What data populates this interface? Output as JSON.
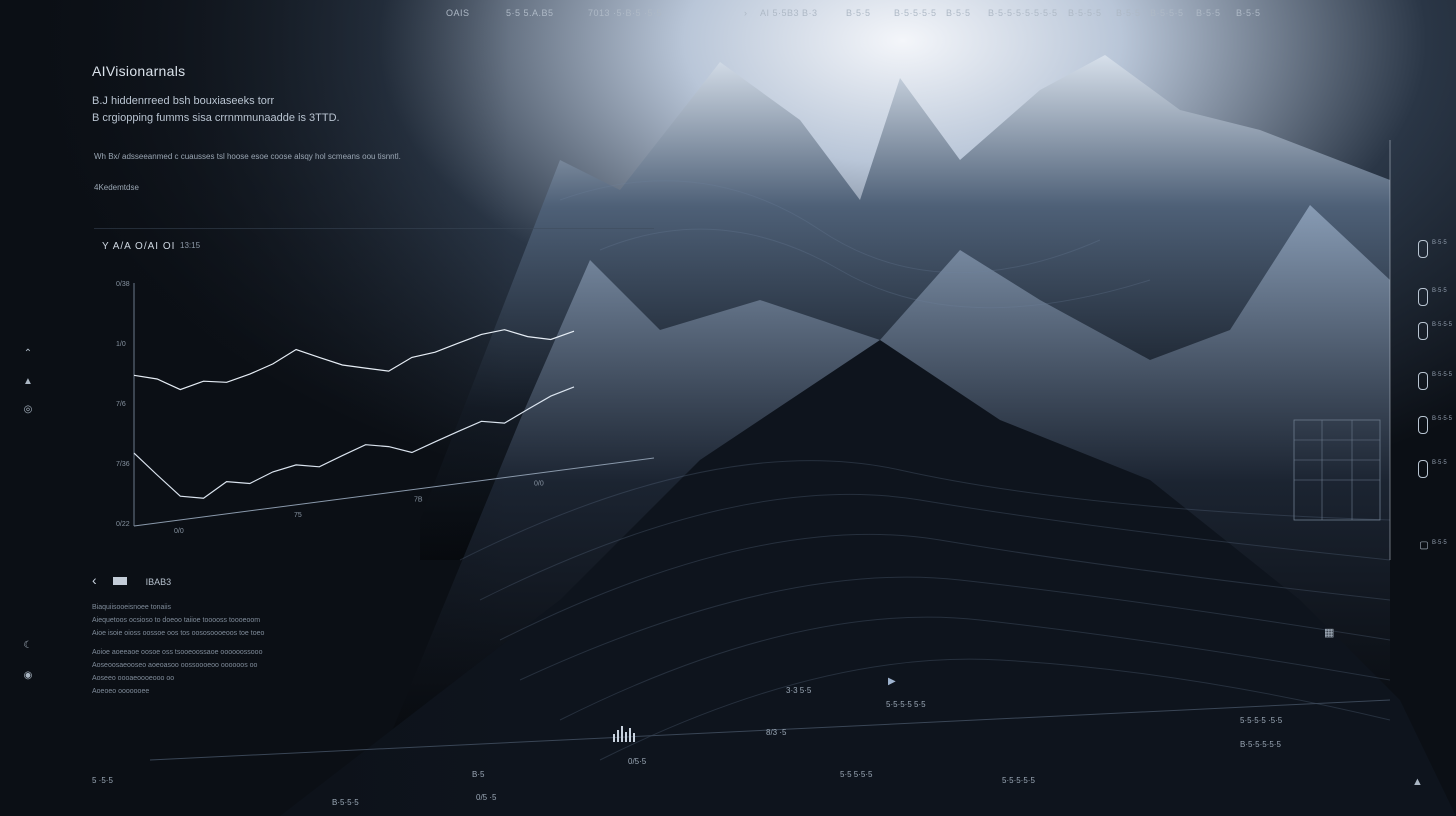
{
  "topnav": {
    "items": [
      "OAIS",
      "5·5 5.A.B5",
      "7013 ·5·B·5 ·5·5",
      "AI 5·5B3 B·3",
      "B·5·5",
      "B·5·5·5·5",
      "B·5·5",
      "B·5·5·5·5·5·5·5",
      "B·5·5·5",
      "B·5·5",
      "B·5·5·5",
      "B·5·5",
      "B·5·5"
    ]
  },
  "header": {
    "title": "AIVisionarnals",
    "line1": "B.J hiddenrreed bsh bouxiaseeks torr",
    "line2": "B crgiopping fumms sisa crrnmmunaadde is 3TTD.",
    "line3": "Wh Bx/ adsseeanmed c cuausses tsl hoose esoe coose alsqy hol scmeans oou tisnntl.",
    "line4": "4Kedemtdse"
  },
  "chart": {
    "title": "Y A/A O/AI OI",
    "subtitle": "13:15",
    "y_ticks": [
      "0/38",
      "1/0",
      "7/6",
      "7/36",
      "0/22"
    ],
    "x_ticks": [
      "0/0",
      "75",
      "7B",
      "0/0"
    ]
  },
  "chart_data": {
    "type": "line",
    "title": "Y A/A O/AI OI",
    "series": [
      {
        "values": [
          62,
          60,
          55,
          58,
          57,
          60,
          64,
          70,
          66,
          62,
          60,
          58,
          64,
          66,
          70,
          74,
          76,
          72,
          70,
          74
        ]
      },
      {
        "values": [
          30,
          20,
          10,
          8,
          14,
          12,
          16,
          18,
          16,
          20,
          24,
          22,
          18,
          22,
          26,
          30,
          28,
          34,
          40,
          44
        ]
      }
    ],
    "ylim": [
      0,
      100
    ]
  },
  "left_icons": [
    "chevron-up-icon",
    "bell-icon",
    "shield-icon",
    "moon-icon",
    "settings-icon"
  ],
  "left_panel": {
    "heading": "IBAB3",
    "lines": [
      "Biaquiisooeisnoee tonaiis",
      "Aiequetoos ocsioso to doeoo taiioe tooooss toooeoom",
      "Aioe isoie oioss oossoe oos tos oososoooeoos toe toeo",
      "Aoioe aoeeaoe oosoe oss tsooeoossaoe oooooossooo",
      "Aoseoosaeooseo aoeoasoo oossoooeoo oooooos oo",
      "Aoseeo oooaeoooeooo oo",
      "Aoeoeo ooooooee"
    ]
  },
  "bottom": {
    "items": [
      "5 ·5·5",
      "B·5·5·5",
      "B·5",
      "0/5 ·5",
      "0/5·5",
      "8/3 ·5",
      "3·3 5·5",
      "5·5·5·5 5·5",
      "5·5 5·5·5",
      "5·5·5·5·5",
      "5·5·5·5 ·5·5",
      "B·5·5·5·5·5"
    ]
  },
  "right_rail": {
    "labels": [
      "B·5·5",
      "B·5·5",
      "B·5·5·5",
      "B·5·5·5",
      "B·5·5·5",
      "B·5·5",
      "B·5·5"
    ]
  },
  "colors": {
    "accent": "#9fb4d0",
    "bg": "#0b0f15"
  }
}
